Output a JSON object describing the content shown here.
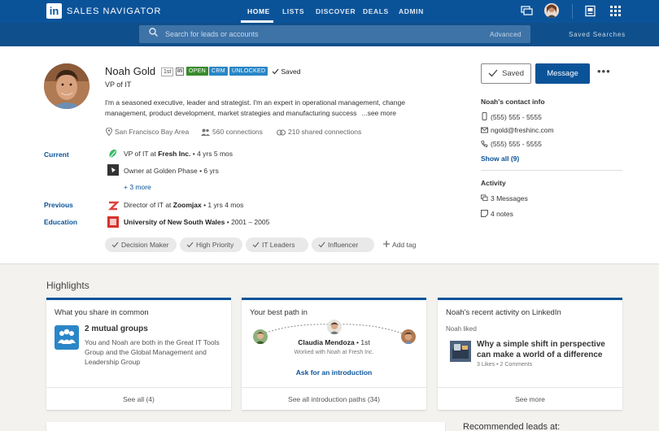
{
  "app": {
    "logo": "in",
    "title": "SALES NAVIGATOR"
  },
  "nav": [
    {
      "label": "HOME",
      "active": true
    },
    {
      "label": "LISTS"
    },
    {
      "label": "DISCOVER"
    },
    {
      "label": "DEALS"
    },
    {
      "label": "ADMIN"
    }
  ],
  "search": {
    "placeholder": "Search for leads or accounts",
    "advanced": "Advanced",
    "saved_searches": "Saved  Searches"
  },
  "profile": {
    "name": "Noah Gold",
    "degree": "1st",
    "li_badge": "in",
    "badges": [
      "OPEN",
      "CRM",
      "UNLOCKED"
    ],
    "saved_label": "Saved",
    "headline": "VP of IT",
    "summary": "I'm a seasoned executive, leader and strategist. I'm an expert in operational management, change management, product development, market strategies and manufacturing success",
    "see_more": "...see more",
    "location": "San Francisco Bay Area",
    "connections": "560 connections",
    "shared": "210 shared connections"
  },
  "current": {
    "label": "Current",
    "positions": [
      {
        "prefix": "VP of IT at ",
        "company": "Fresh Inc.",
        "duration": " • 4 yrs 5 mos"
      },
      {
        "prefix": "Owner at Golden Phase",
        "company": "",
        "duration": " • 6 yrs"
      }
    ],
    "more": "+ 3 more"
  },
  "previous": {
    "label": "Previous",
    "prefix": "Director of IT at ",
    "company": "Zoomjax",
    "duration": " • 1 yrs 4 mos"
  },
  "education": {
    "label": "Education",
    "school": "University of New South Wales",
    "years": " • 2001 – 2005"
  },
  "tags": [
    "Decision Maker",
    "High Priority",
    "IT Leaders",
    "Influencer"
  ],
  "add_tag": "Add tag",
  "actions": {
    "saved": "Saved",
    "message": "Message",
    "more": "•••"
  },
  "contact": {
    "title": "Noah's contact info",
    "phone1": "(555) 555 - 5555",
    "email": "ngold@freshinc.com",
    "phone2": "(555) 555 - 5555",
    "show_all": "Show all (9)"
  },
  "activity": {
    "title": "Activity",
    "messages": "3 Messages",
    "notes": "4 notes"
  },
  "highlights": {
    "title": "Highlights",
    "common": {
      "title": "What you share in common",
      "heading": "2 mutual groups",
      "desc": "You and Noah are both in the Great IT Tools Group and the Global Management and Leadership Group",
      "footer": "See all (4)"
    },
    "path": {
      "title": "Your best path in",
      "name": "Claudia Mendoza",
      "degree": " • 1st",
      "sub": "Worked with Noah at Fresh Inc.",
      "ask": "Ask for an introduction",
      "footer": "See all introduction paths  (34)"
    },
    "activity": {
      "title": "Noah's recent activity on LinkedIn",
      "sub": "Noah liked",
      "post": "Why a simple shift in perspective can make a world of a difference",
      "meta": "3 Likes  •  2 Comments",
      "footer": "See more"
    }
  },
  "recommended": "Recommended leads at:",
  "colors": {
    "brand": "#0b5399",
    "open": "#3a8a2e",
    "crm": "#2a86c7"
  }
}
